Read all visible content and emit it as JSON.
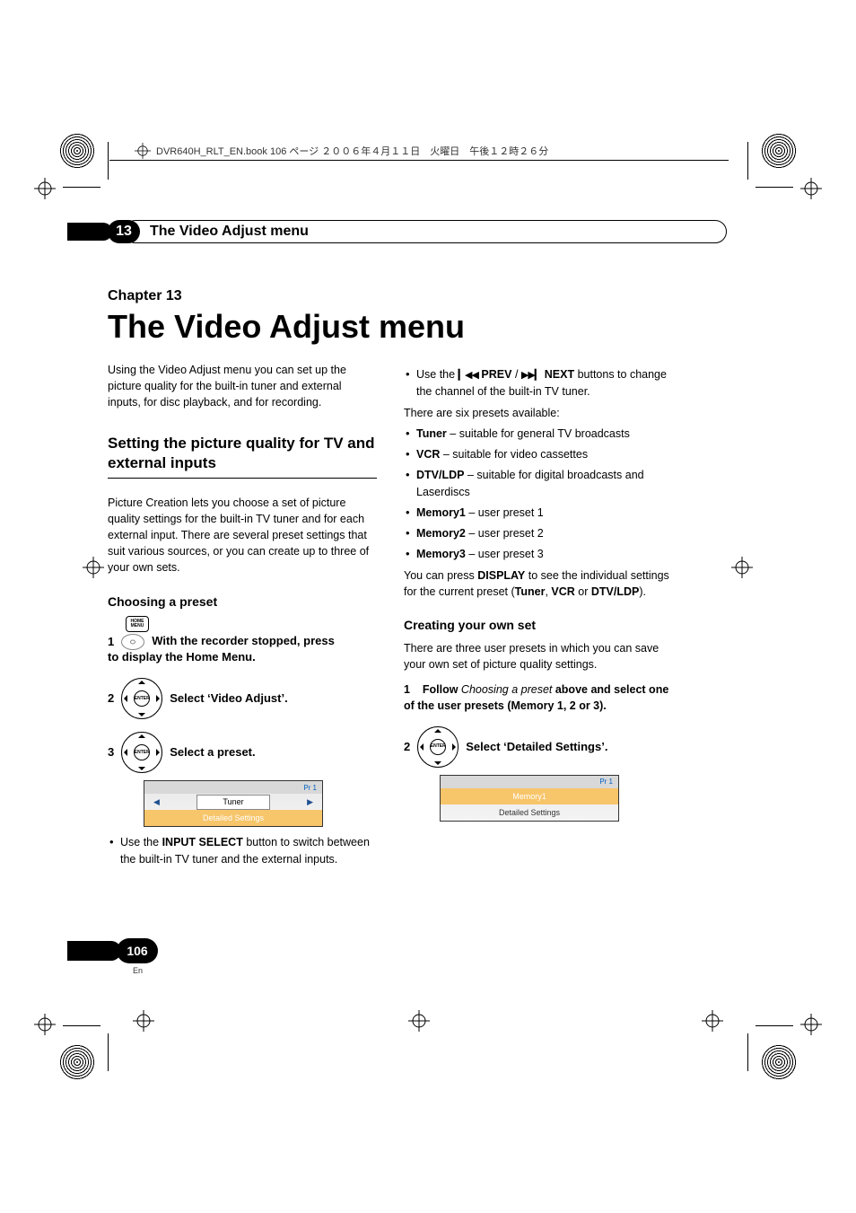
{
  "header_line": "DVR640H_RLT_EN.book  106 ページ  ２００６年４月１１日　火曜日　午後１２時２６分",
  "chapter_number": "13",
  "chapter_bar_title": "The Video Adjust menu",
  "chapter_label": "Chapter 13",
  "main_title": "The Video Adjust menu",
  "intro": "Using the Video Adjust menu you can set up the picture quality for the built-in tuner and external inputs, for disc playback, and for recording.",
  "section1_title": "Setting the picture quality for TV and external inputs",
  "section1_body": "Picture Creation lets you choose a set of picture quality settings for the built-in TV tuner and for each external input. There are several preset settings that suit various sources, or you can create up to three of your own sets.",
  "sub1_title": "Choosing a preset",
  "btn_home_l1": "HOME",
  "btn_home_l2": "MENU",
  "dpad_center": "ENTER",
  "step1_num": "1",
  "step1_text_a": "With the recorder stopped, press",
  "step1_text_b": "to display the Home Menu.",
  "step2_num": "2",
  "step2_text": "Select ‘Video Adjust’.",
  "step3_num": "3",
  "step3_text": "Select a preset.",
  "panel1": {
    "badge": "Pr 1",
    "value": "Tuner",
    "row2": "Detailed Settings"
  },
  "bullet_input": {
    "prefix": "Use the ",
    "bold": "INPUT SELECT",
    "suffix": " button to switch between the built-in TV tuner and the external inputs."
  },
  "bullet_prevnext": {
    "prefix": "Use the ",
    "prev_icon": "▎◀◀",
    "prev": " PREV",
    "slash": " / ",
    "next_icon": "▶▶▎",
    "next": " NEXT",
    "suffix": " buttons to change the channel of the built-in TV tuner."
  },
  "presets_intro": "There are six presets available:",
  "presets": [
    {
      "name": "Tuner",
      "desc": " – suitable for general TV broadcasts"
    },
    {
      "name": "VCR",
      "desc": " – suitable for video cassettes"
    },
    {
      "name": "DTV/LDP",
      "desc": " – suitable for digital broadcasts and Laserdiscs"
    },
    {
      "name": "Memory1",
      "desc": " – user preset 1"
    },
    {
      "name": "Memory2",
      "desc": " – user preset 2"
    },
    {
      "name": "Memory3",
      "desc": " – user preset 3"
    }
  ],
  "display_line": {
    "a": "You can press ",
    "b": "DISPLAY",
    "c": " to see the individual settings for the current preset (",
    "d": "Tuner",
    "e": ", ",
    "f": "VCR",
    "g": " or ",
    "h": "DTV/LDP",
    "i": ")."
  },
  "sub2_title": "Creating your own set",
  "sub2_body": "There are three user presets in which you can save your own set of picture quality settings.",
  "stepB1_num": "1",
  "stepB1_a": "Follow ",
  "stepB1_i": "Choosing a preset",
  "stepB1_b": " above and select one of the user presets (Memory 1, 2 or 3).",
  "stepB2_num": "2",
  "stepB2_text": "Select ‘Detailed Settings’.",
  "panel2": {
    "badge": "Pr 1",
    "row1": "Memory1",
    "row2": "Detailed Settings"
  },
  "page_number": "106",
  "page_lang": "En"
}
